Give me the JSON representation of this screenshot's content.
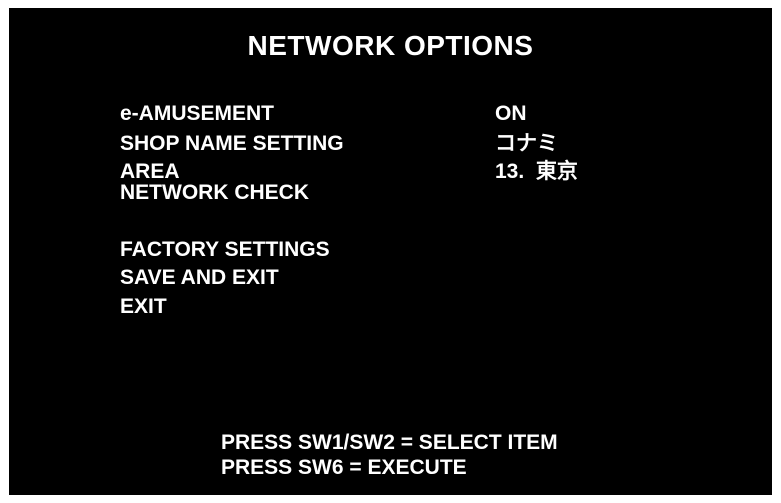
{
  "title": "NETWORK OPTIONS",
  "menu": {
    "e_amusement": {
      "label": "e-AMUSEMENT",
      "value": "ON"
    },
    "shop_name": {
      "label": "SHOP NAME SETTING",
      "value": "コナミ"
    },
    "area": {
      "label": "AREA",
      "value": "13.  東京"
    },
    "network_check": {
      "label": "NETWORK CHECK"
    },
    "factory_settings": {
      "label": "FACTORY SETTINGS"
    },
    "save_and_exit": {
      "label": "SAVE AND EXIT"
    },
    "exit": {
      "label": "EXIT"
    }
  },
  "footer": {
    "line1": "PRESS SW1/SW2 = SELECT ITEM",
    "line2": "PRESS SW6 = EXECUTE"
  },
  "colors": {
    "background": "#000000",
    "text": "#ffffff",
    "frame": "#ffffff"
  }
}
